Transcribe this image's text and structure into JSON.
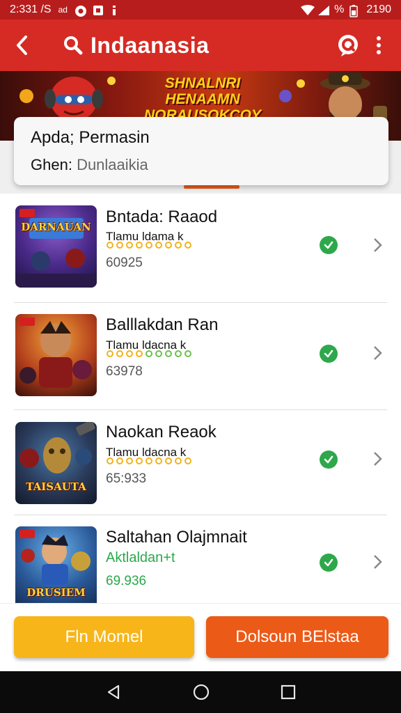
{
  "status_bar": {
    "time": "2:331 /S",
    "indicator": "ad",
    "right_text": "2190",
    "percent": "%"
  },
  "app_bar": {
    "title": "Indaanasia",
    "icons": [
      "back-arrow-icon",
      "search-icon",
      "help-icon",
      "more-vert-icon"
    ]
  },
  "banner": {
    "line1": "SHNALNRI HENAAMN",
    "line2": "NORAUSOKCOY"
  },
  "info_card": {
    "line1": "Apda; Permasin",
    "line2_label": "Ghen:",
    "line2_value": "Dunlaaikia"
  },
  "list": {
    "items": [
      {
        "title": "Bntada: Raaod",
        "subtitle": "Tlamu ldama k",
        "code": "60925",
        "thumb_title": "DARNAUAN",
        "status": "check-icon"
      },
      {
        "title": "Balllakdan Ran",
        "subtitle": "Tlamu ldacna k",
        "code": "63978",
        "thumb_title": "",
        "status": "check-icon"
      },
      {
        "title": "Naokan Reaok",
        "subtitle": "Tlamu ldacna k",
        "code": "65:933",
        "thumb_title": "TAISAUTA",
        "status": "check-icon"
      },
      {
        "title": "Saltahan Olajmnait",
        "subtitle": "Aktlaldan+t",
        "code": "69.936",
        "thumb_title": "DRUSIEM",
        "status": "check-icon"
      }
    ]
  },
  "buttons": {
    "left_label": "Fln Momel",
    "right_label": "Dolsoun BElstaa"
  },
  "colors": {
    "app_bar": "#d52b24",
    "status_bar": "#b81d1d",
    "accent_yellow": "#f7b51a",
    "accent_orange": "#ec5a17",
    "check_green": "#2ea84a"
  }
}
